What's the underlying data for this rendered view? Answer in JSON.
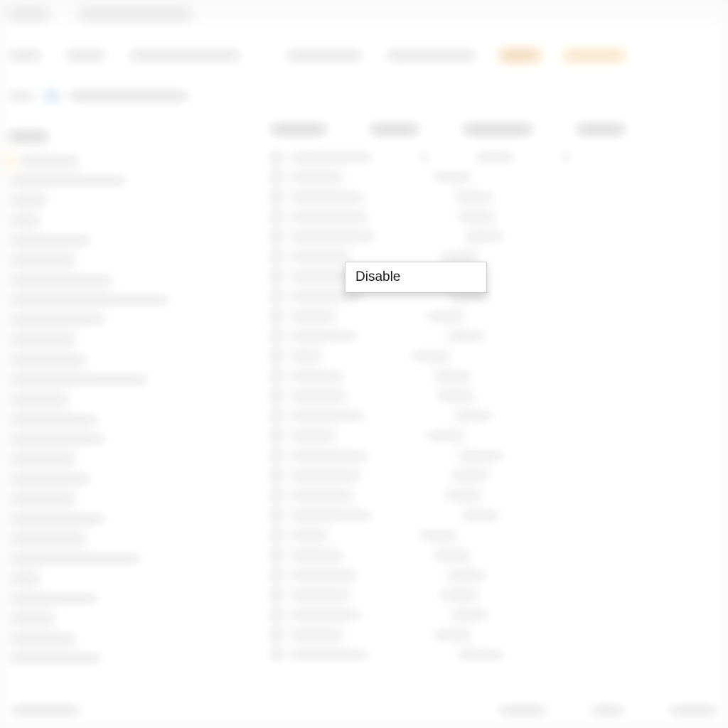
{
  "window": {
    "title_left": "",
    "title_center": ""
  },
  "toolbar": {
    "items": [
      "",
      "",
      "",
      "",
      "",
      "",
      "",
      ""
    ]
  },
  "breadcrumb": {
    "path": ""
  },
  "sidebar": {
    "header": "",
    "items": [
      "",
      "",
      "",
      "",
      "",
      "",
      "",
      "",
      "",
      "",
      "",
      "",
      "",
      "",
      "",
      "",
      "",
      "",
      "",
      "",
      "",
      "",
      "",
      "",
      "",
      ""
    ]
  },
  "table": {
    "columns": [
      "",
      "",
      "",
      ""
    ],
    "rows": [
      [
        "",
        "",
        "",
        ""
      ],
      [
        "",
        "",
        "",
        ""
      ],
      [
        "",
        "",
        "",
        ""
      ],
      [
        "",
        "",
        "",
        ""
      ],
      [
        "",
        "",
        "",
        ""
      ],
      [
        "",
        "",
        "",
        ""
      ],
      [
        "",
        "",
        "",
        ""
      ],
      [
        "",
        "",
        "",
        ""
      ],
      [
        "",
        "",
        "",
        ""
      ],
      [
        "",
        "",
        "",
        ""
      ],
      [
        "",
        "",
        "",
        ""
      ],
      [
        "",
        "",
        "",
        ""
      ],
      [
        "",
        "",
        "",
        ""
      ],
      [
        "",
        "",
        "",
        ""
      ],
      [
        "",
        "",
        "",
        ""
      ],
      [
        "",
        "",
        "",
        ""
      ],
      [
        "",
        "",
        "",
        ""
      ],
      [
        "",
        "",
        "",
        ""
      ],
      [
        "",
        "",
        "",
        ""
      ],
      [
        "",
        "",
        "",
        ""
      ],
      [
        "",
        "",
        "",
        ""
      ],
      [
        "",
        "",
        "",
        ""
      ],
      [
        "",
        "",
        "",
        ""
      ],
      [
        "",
        "",
        "",
        ""
      ],
      [
        "",
        "",
        "",
        ""
      ],
      [
        "",
        "",
        "",
        ""
      ]
    ]
  },
  "statusbar": {
    "left": "",
    "mid": "",
    "right1": "",
    "right2": ""
  },
  "context_menu": {
    "items": [
      {
        "label": "Disable"
      }
    ]
  }
}
